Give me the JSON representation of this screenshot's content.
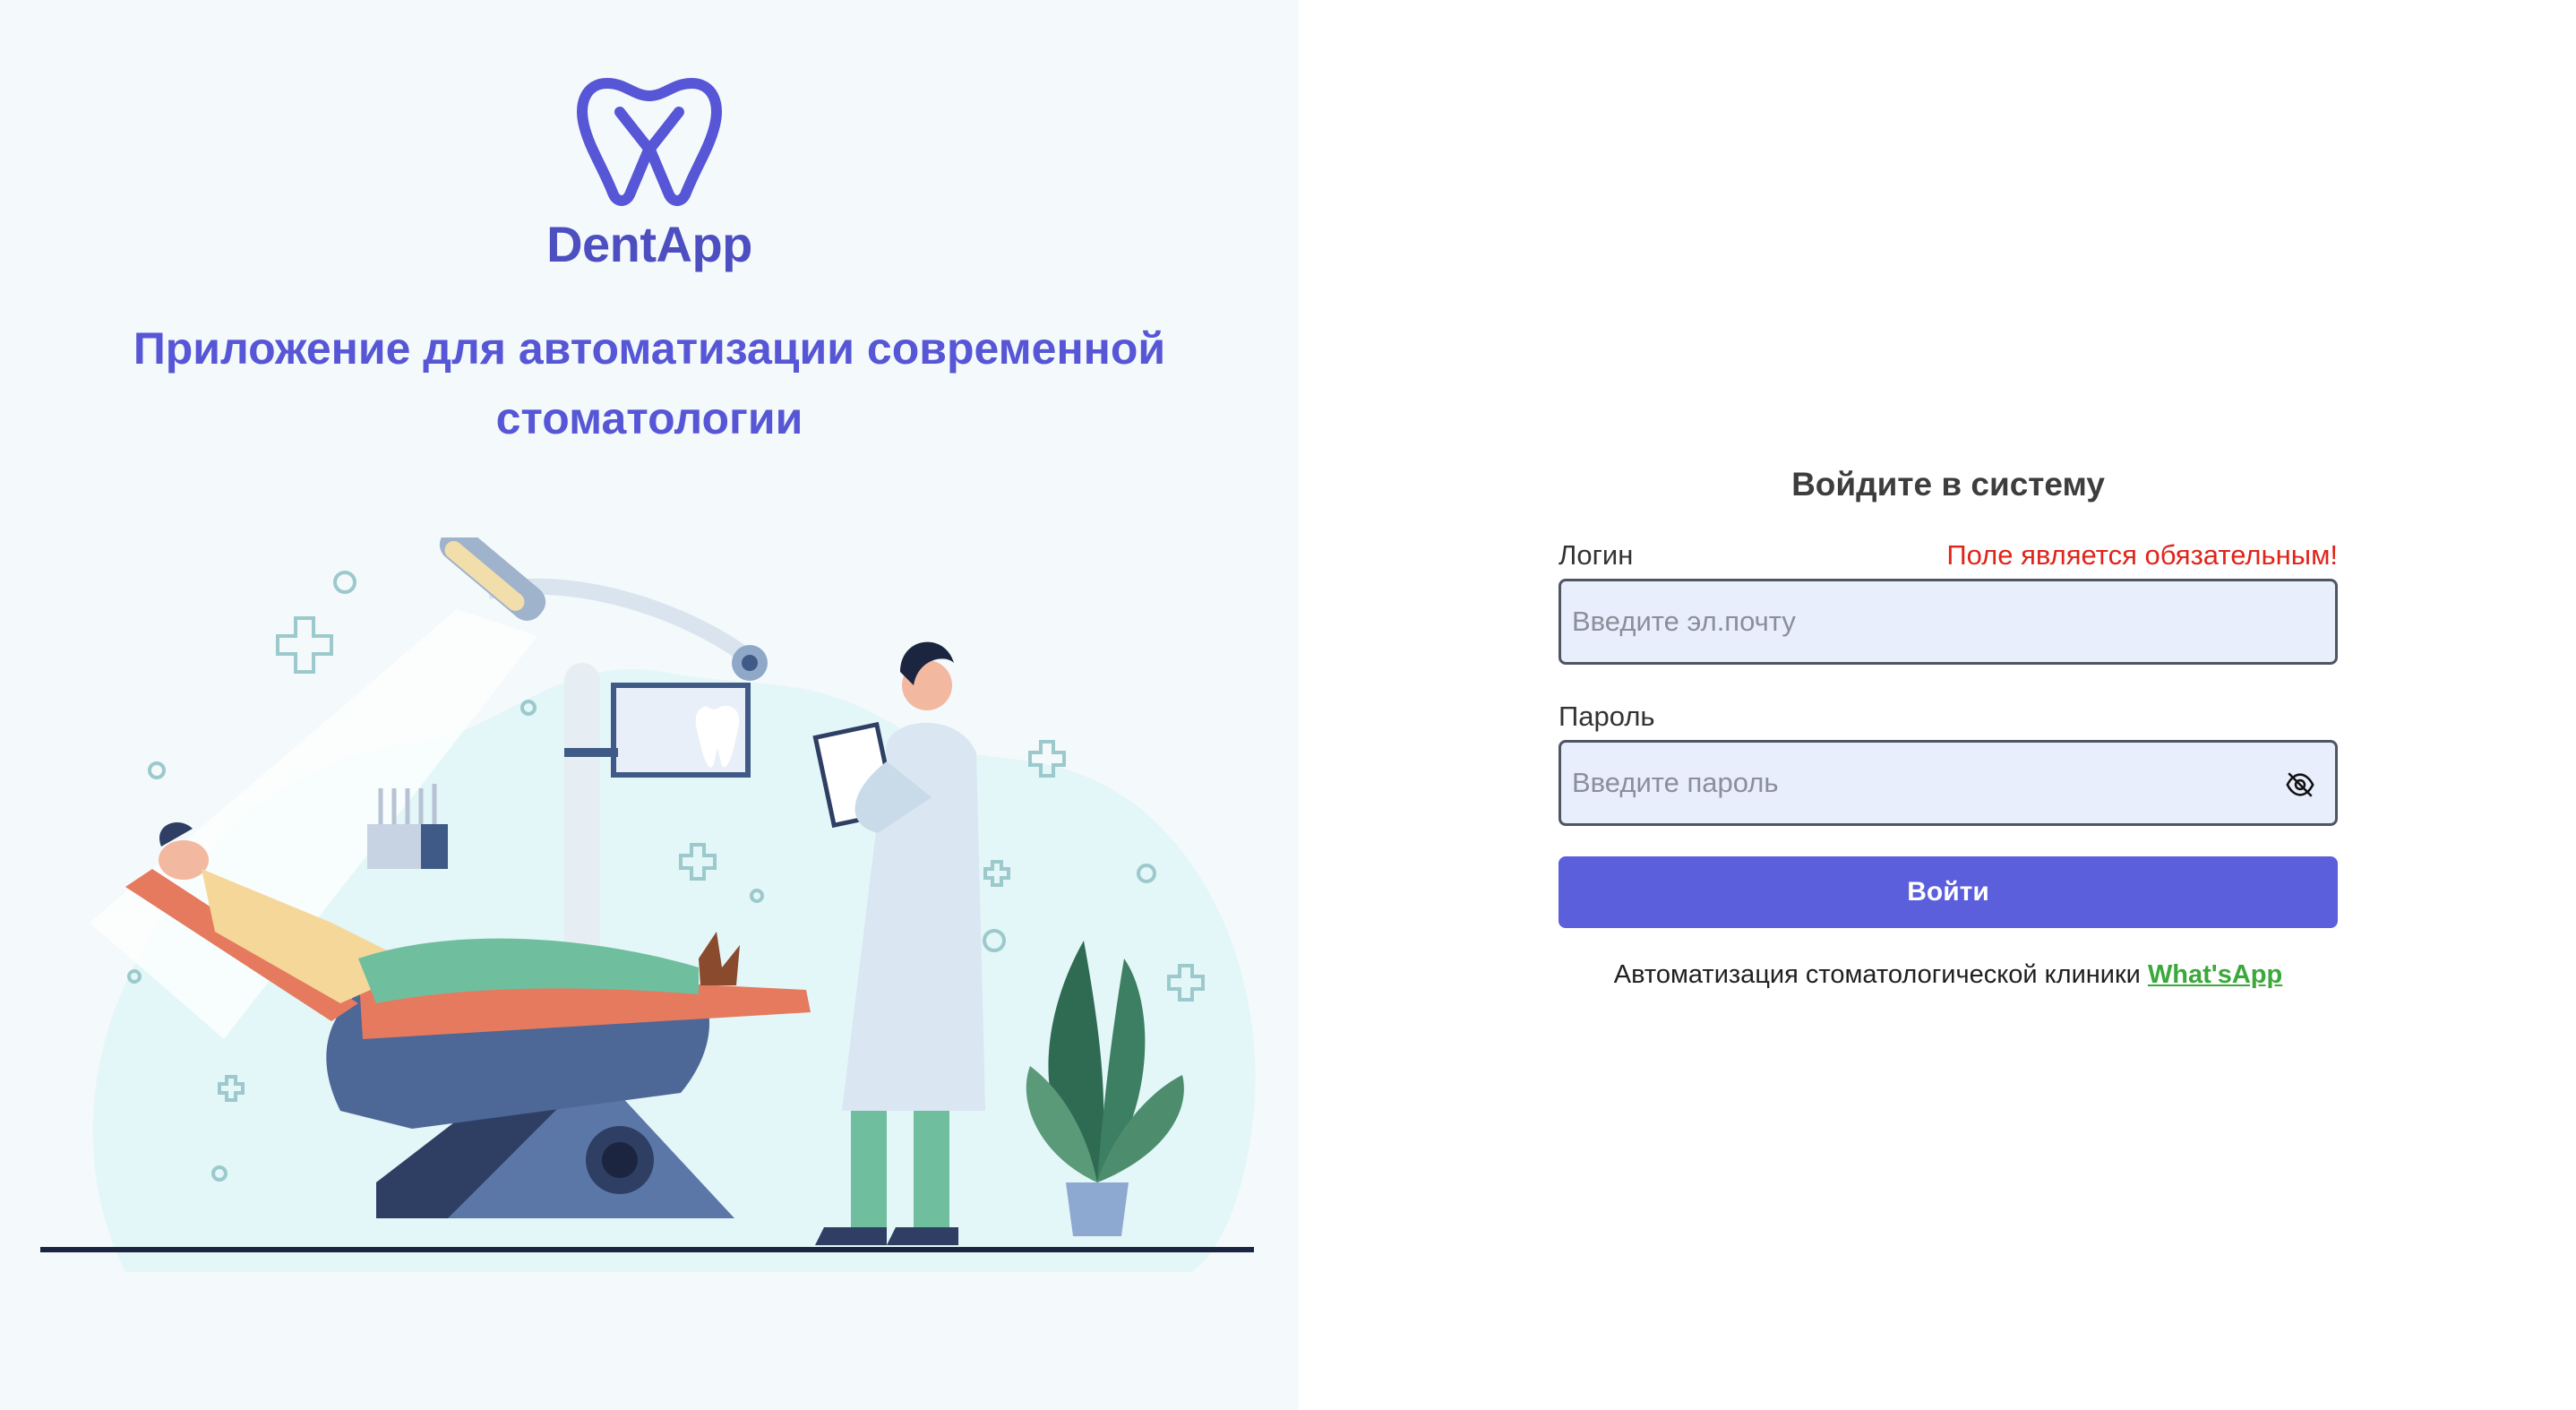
{
  "brand": {
    "name": "DentApp",
    "tagline": "Приложение для автоматизации современной стоматологии"
  },
  "login_form": {
    "title": "Войдите в систему",
    "email": {
      "label": "Логин",
      "error": "Поле является обязательным!",
      "placeholder": "Введите эл.почту",
      "value": ""
    },
    "password": {
      "label": "Пароль",
      "placeholder": "Введите пароль",
      "value": "",
      "toggle_icon": "eye-slash-icon"
    },
    "submit_label": "Войти"
  },
  "footer": {
    "text": "Автоматизация стоматологической клиники",
    "link_label": "What'sApp"
  },
  "colors": {
    "brand": "#5656d6",
    "button": "#5b5fdc",
    "error": "#e0241a",
    "link": "#3aa83a",
    "left_panel_bg": "#f4f9fb",
    "input_bg": "#e8eefc"
  }
}
